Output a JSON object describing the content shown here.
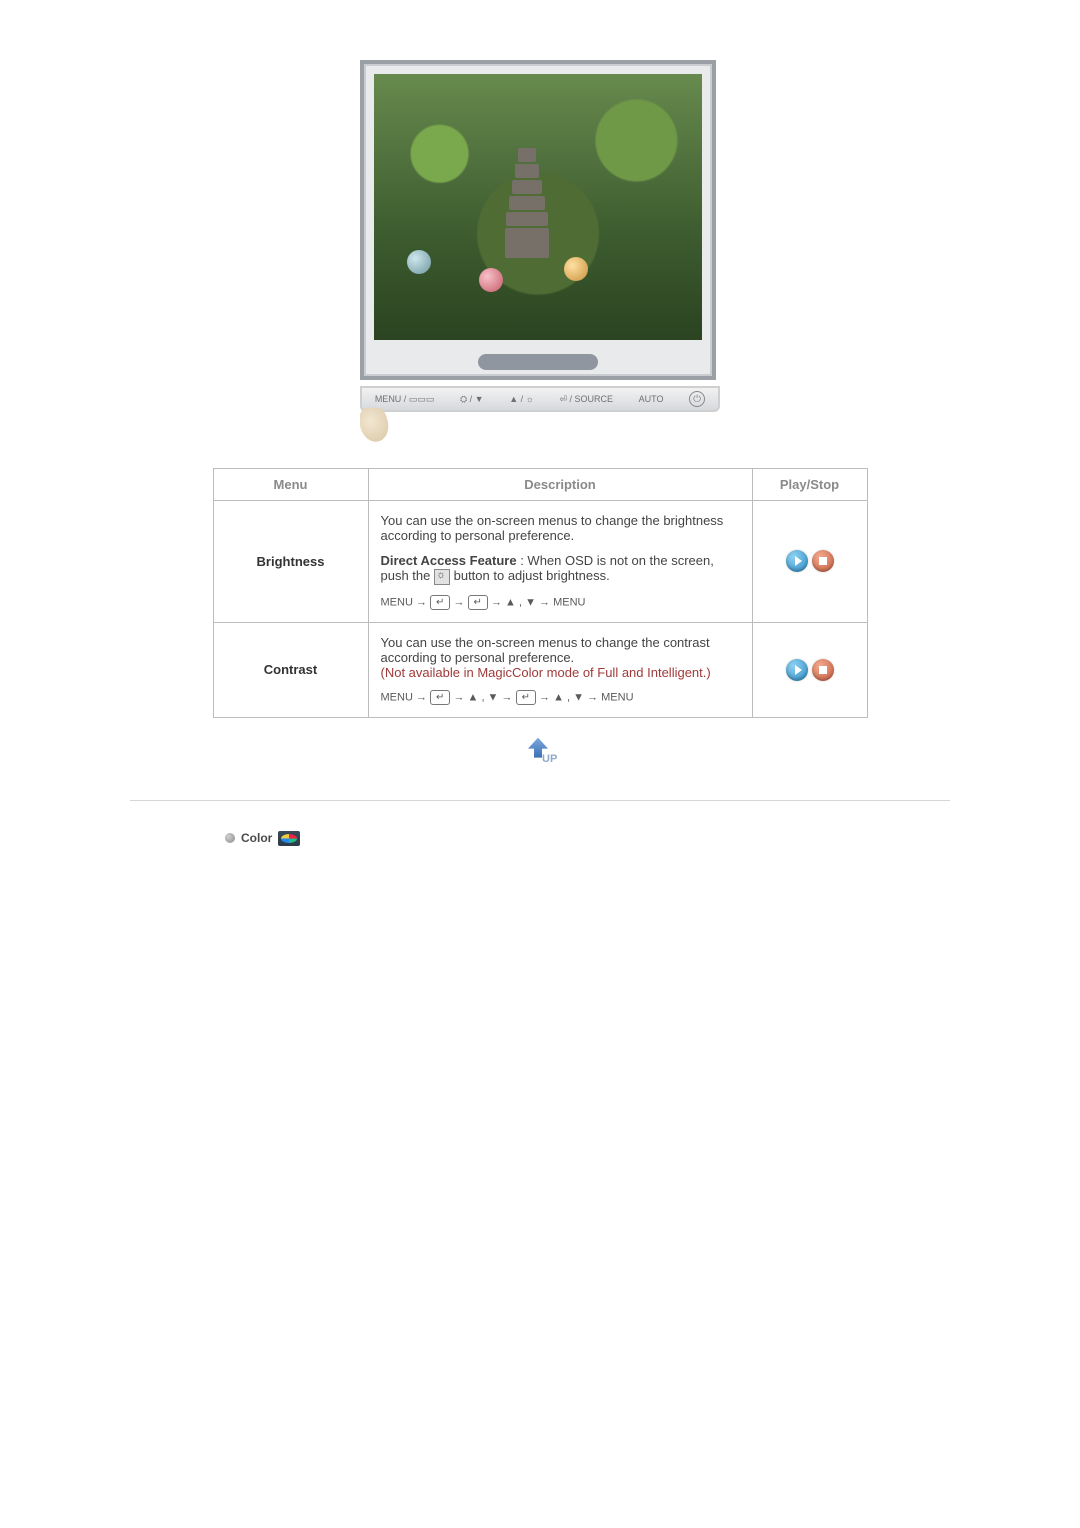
{
  "monitor": {
    "buttons": [
      "MENU / ▭▭▭",
      "⛭ / ▼",
      "▲ / ☼",
      "⏎ / SOURCE",
      "AUTO"
    ]
  },
  "table": {
    "headers": {
      "menu": "Menu",
      "description": "Description",
      "playstop": "Play/Stop"
    },
    "rows": [
      {
        "menu": "Brightness",
        "desc1": "You can use the on-screen menus to change the brightness according to personal preference.",
        "desc2a": "Direct Access Feature",
        "desc2b": " : When OSD is not on the screen, push the ",
        "desc2c": " button to adjust brightness.",
        "seq_parts": [
          "MENU → ",
          " → ",
          " → ▲ , ▼ → MENU"
        ]
      },
      {
        "menu": "Contrast",
        "desc1": "You can use the on-screen menus to change the contrast according to personal preference.",
        "note": "(Not available in MagicColor mode of Full and Intelligent.)",
        "seq_parts": [
          "MENU → ",
          " → ▲ , ▼ → ",
          " → ▲ , ▼ → MENU"
        ]
      }
    ]
  },
  "up_label": "UP",
  "enter_glyph": "↵",
  "section": {
    "title": "Color"
  }
}
